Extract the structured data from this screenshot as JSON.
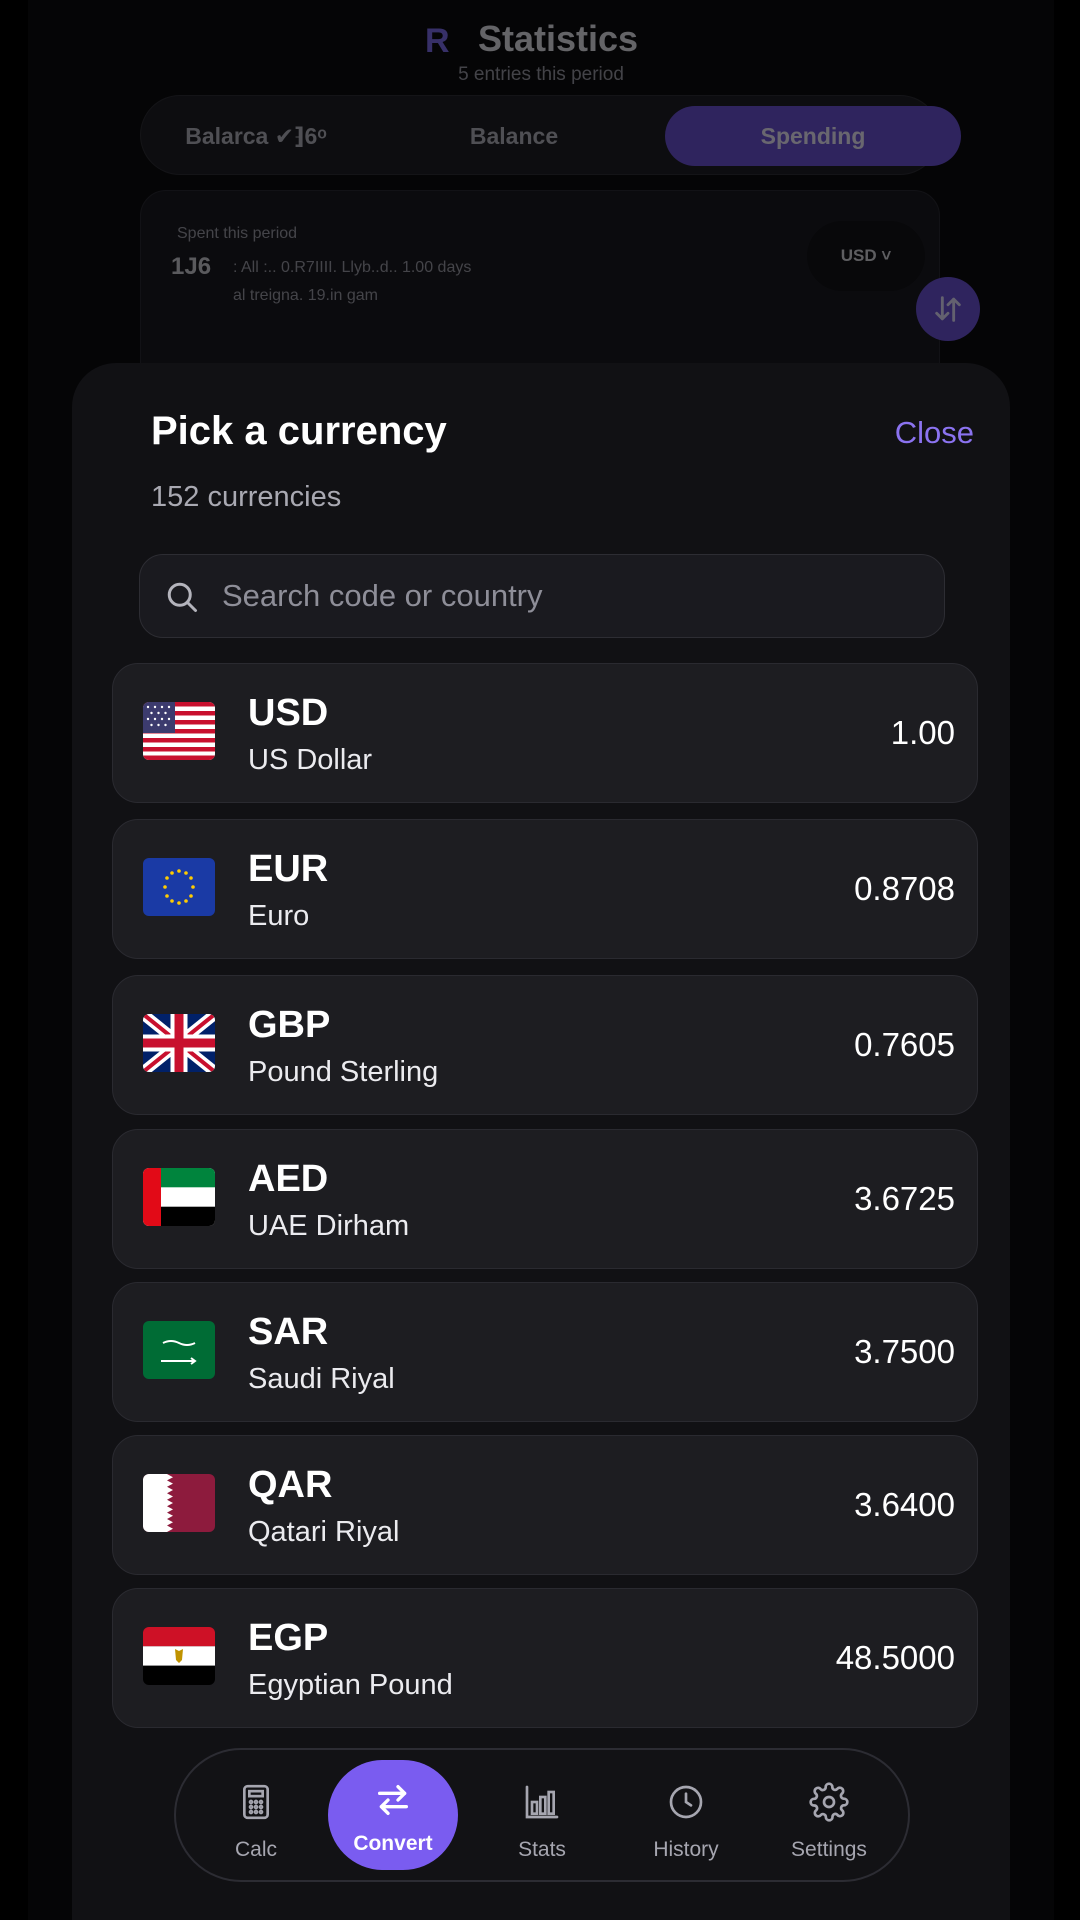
{
  "background_screen": {
    "title": "Statistics",
    "subtitle": "5 entries this period",
    "segments": [
      "Balarca ✔⁆6ᵒ",
      "Balance",
      "Spending"
    ],
    "active_segment": "Spending",
    "card_label": "Spent this period",
    "card_value": "1J6",
    "card_line1": ": All :.. 0.R7IIII. Llyb..d.. 1.00 days",
    "card_line2": "al treigna. 19.in gam",
    "currency_pill": "USD ˅"
  },
  "sheet": {
    "title": "Pick a currency",
    "close_label": "Close",
    "count_text": "152 currencies",
    "search_placeholder": "Search code or country"
  },
  "currencies": [
    {
      "code": "USD",
      "name": "US Dollar",
      "rate": "1.00",
      "flag": "us-flag-icon"
    },
    {
      "code": "EUR",
      "name": "Euro",
      "rate": "0.8708",
      "flag": "eu-flag-icon"
    },
    {
      "code": "GBP",
      "name": "Pound Sterling",
      "rate": "0.7605",
      "flag": "uk-flag-icon"
    },
    {
      "code": "AED",
      "name": "UAE Dirham",
      "rate": "3.6725",
      "flag": "uae-flag-icon"
    },
    {
      "code": "SAR",
      "name": "Saudi Riyal",
      "rate": "3.7500",
      "flag": "saudi-flag-icon"
    },
    {
      "code": "QAR",
      "name": "Qatari Riyal",
      "rate": "3.6400",
      "flag": "qatar-flag-icon"
    },
    {
      "code": "EGP",
      "name": "Egyptian Pound",
      "rate": "48.5000",
      "flag": "egypt-flag-icon"
    }
  ],
  "nav": {
    "items": [
      {
        "label": "Calc",
        "icon": "calculator-icon"
      },
      {
        "label": "Convert",
        "icon": "swap-arrows-icon"
      },
      {
        "label": "Stats",
        "icon": "bar-chart-icon"
      },
      {
        "label": "History",
        "icon": "clock-icon"
      },
      {
        "label": "Settings",
        "icon": "gear-icon"
      }
    ],
    "active": "Convert"
  },
  "colors": {
    "accent": "#7a5cf0",
    "sheet_bg": "#111114",
    "row_bg": "#1d1d21"
  }
}
